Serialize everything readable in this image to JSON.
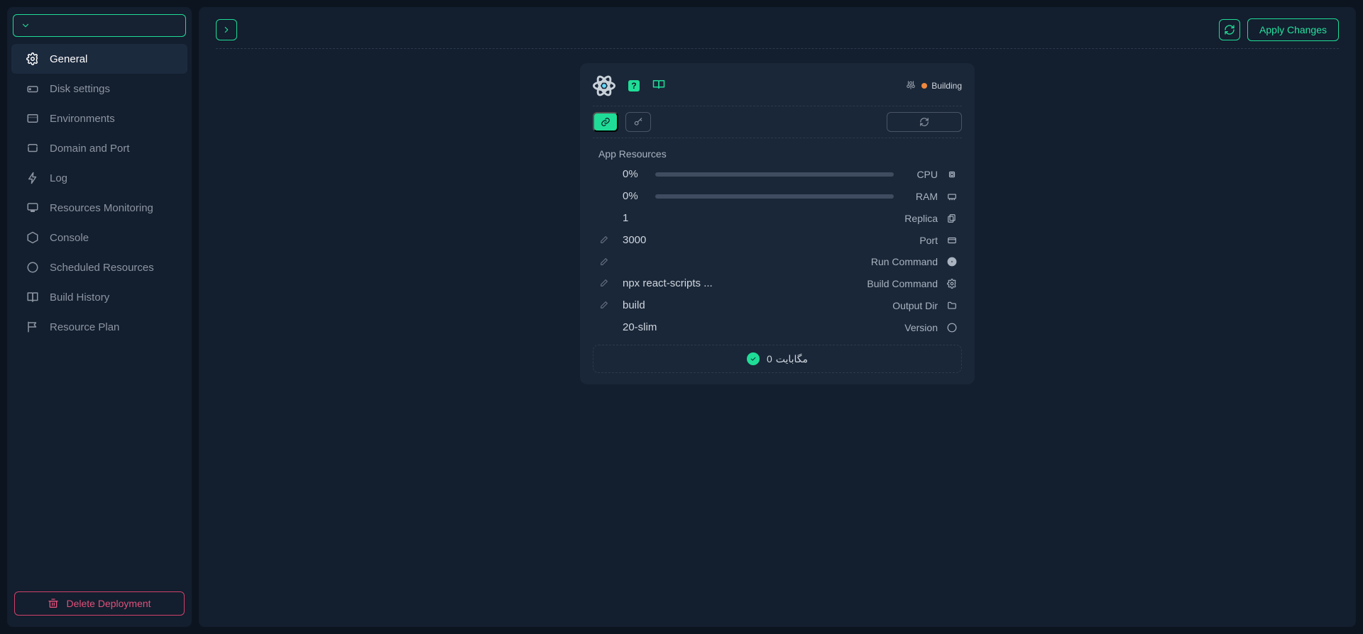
{
  "sidebar": {
    "items": [
      {
        "label": "General"
      },
      {
        "label": "Disk settings"
      },
      {
        "label": "Environments"
      },
      {
        "label": "Domain and Port"
      },
      {
        "label": "Log"
      },
      {
        "label": "Resources Monitoring"
      },
      {
        "label": "Console"
      },
      {
        "label": "Scheduled Resources"
      },
      {
        "label": "Build History"
      },
      {
        "label": "Resource Plan"
      }
    ],
    "delete_label": "Delete Deployment"
  },
  "topbar": {
    "apply_label": "Apply Changes"
  },
  "card": {
    "help_text": "?",
    "status_label": "Building",
    "section_title": "App Resources",
    "rows": {
      "cpu": {
        "value": "0%",
        "label": "CPU"
      },
      "ram": {
        "value": "0%",
        "label": "RAM"
      },
      "replica": {
        "value": "1",
        "label": "Replica"
      },
      "port": {
        "value": "3000",
        "label": "Port"
      },
      "run": {
        "value": "",
        "label": "Run Command"
      },
      "build": {
        "value": "npx react-scripts ...",
        "label": "Build Command"
      },
      "output": {
        "value": "build",
        "label": "Output Dir"
      },
      "version": {
        "value": "20-slim",
        "label": "Version"
      }
    },
    "storage": {
      "amount": "0",
      "unit": "مگابایت"
    }
  }
}
